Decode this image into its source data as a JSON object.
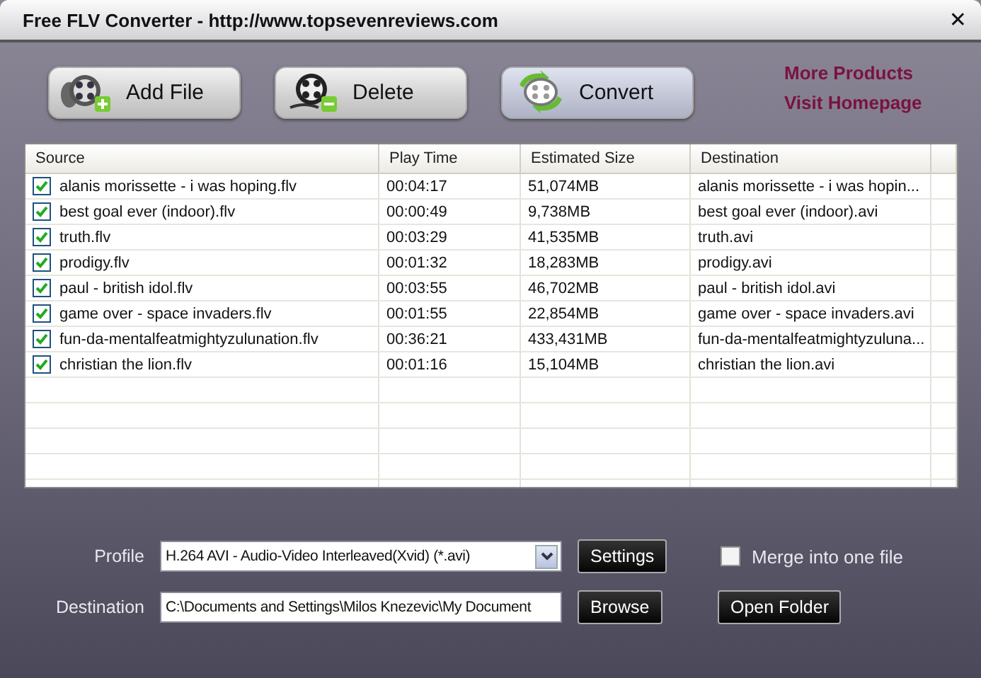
{
  "window": {
    "title": "Free FLV Converter - http://www.topsevenreviews.com",
    "close": "✕"
  },
  "toolbar": [
    {
      "kind": "add",
      "label": "Add File",
      "selected": false
    },
    {
      "kind": "delete",
      "label": "Delete",
      "selected": false
    },
    {
      "kind": "convert",
      "label": "Convert",
      "selected": true
    }
  ],
  "links": [
    "More Products",
    "Visit Homepage"
  ],
  "table": {
    "columns": [
      "Source",
      "Play Time",
      "Estimated Size",
      "Destination"
    ],
    "rows": [
      {
        "checked": true,
        "source": "alanis morissette - i was hoping.flv",
        "time": "00:04:17",
        "size": "51,074MB",
        "destination": "alanis morissette - i was hopin..."
      },
      {
        "checked": true,
        "source": "best goal ever (indoor).flv",
        "time": "00:00:49",
        "size": "9,738MB",
        "destination": "best goal ever (indoor).avi"
      },
      {
        "checked": true,
        "source": "truth.flv",
        "time": "00:03:29",
        "size": "41,535MB",
        "destination": "truth.avi"
      },
      {
        "checked": true,
        "source": "prodigy.flv",
        "time": "00:01:32",
        "size": "18,283MB",
        "destination": "prodigy.avi"
      },
      {
        "checked": true,
        "source": "paul - british idol.flv",
        "time": "00:03:55",
        "size": "46,702MB",
        "destination": "paul - british idol.avi"
      },
      {
        "checked": true,
        "source": "game over - space invaders.flv",
        "time": "00:01:55",
        "size": "22,854MB",
        "destination": "game over - space invaders.avi"
      },
      {
        "checked": true,
        "source": "fun-da-mentalfeatmightyzulunation.flv",
        "time": "00:36:21",
        "size": "433,431MB",
        "destination": "fun-da-mentalfeatmightyzuluna..."
      },
      {
        "checked": true,
        "source": "christian the lion.flv",
        "time": "00:01:16",
        "size": "15,104MB",
        "destination": "christian the lion.avi"
      }
    ]
  },
  "profile": {
    "label": "Profile",
    "value": "H.264 AVI - Audio-Video Interleaved(Xvid) (*.avi)",
    "button": "Settings",
    "merge": {
      "label": "Merge into one file",
      "checked": false
    }
  },
  "destination": {
    "label": "Destination",
    "value": "C:\\Documents and Settings\\Milos Knezevic\\My Document",
    "buttons": [
      "Browse",
      "Open Folder"
    ]
  }
}
